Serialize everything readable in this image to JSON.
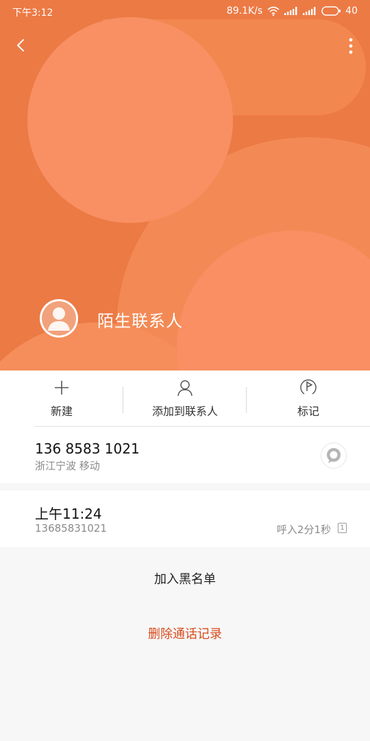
{
  "status_bar": {
    "time": "下午3:12",
    "network_speed": "89.1K/s",
    "battery": "40"
  },
  "header": {
    "contact_name": "陌生联系人",
    "back_icon": "chevron-left-icon",
    "more_icon": "more-vertical-icon",
    "avatar_icon": "person-silhouette-icon",
    "background_color": "#ec7a45"
  },
  "actions": [
    {
      "label": "新建",
      "icon": "plus-icon"
    },
    {
      "label": "添加到联系人",
      "icon": "person-icon"
    },
    {
      "label": "标记",
      "icon": "flag-icon"
    }
  ],
  "phone": {
    "number": "136 8583 1021",
    "location": "浙江宁波 移动",
    "message_icon": "message-bubble-icon"
  },
  "call_record": {
    "time": "上午11:24",
    "number": "13685831021",
    "detail": "呼入2分1秒",
    "sim_slot": "1"
  },
  "bottom_actions": {
    "blacklist_label": "加入黑名单",
    "delete_label": "删除通话记录",
    "delete_color": "#d84a1b"
  }
}
